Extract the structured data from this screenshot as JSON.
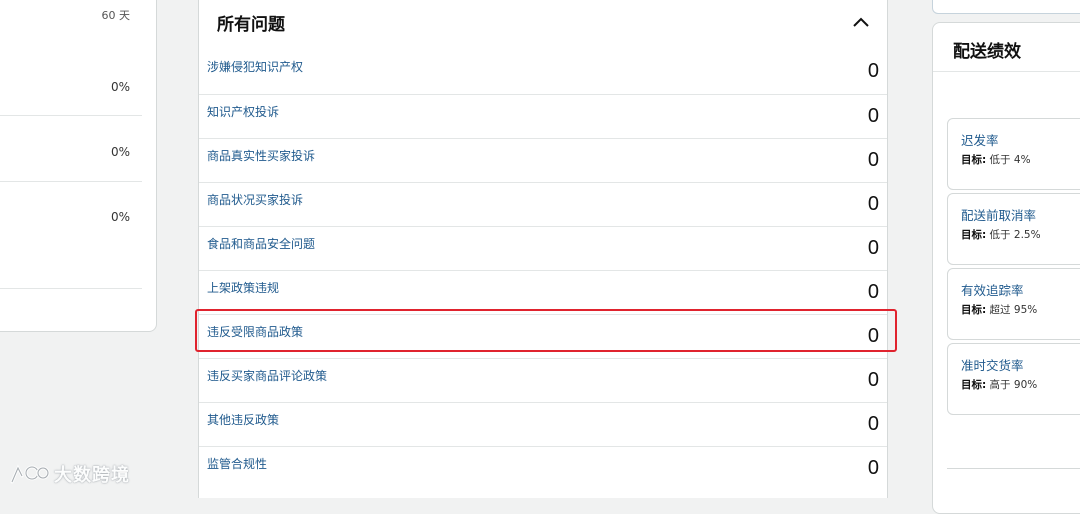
{
  "left_panel": {
    "top_value": "60 天",
    "values": [
      "0%",
      "0%",
      "0%"
    ]
  },
  "issues_panel": {
    "title": "所有问题",
    "rows": [
      {
        "label": "涉嫌侵犯知识产权",
        "count": "0"
      },
      {
        "label": "知识产权投诉",
        "count": "0"
      },
      {
        "label": "商品真实性买家投诉",
        "count": "0"
      },
      {
        "label": "商品状况买家投诉",
        "count": "0"
      },
      {
        "label": "食品和商品安全问题",
        "count": "0"
      },
      {
        "label": "上架政策违规",
        "count": "0"
      },
      {
        "label": "违反受限商品政策",
        "count": "0"
      },
      {
        "label": "违反买家商品评论政策",
        "count": "0"
      },
      {
        "label": "其他违反政策",
        "count": "0"
      },
      {
        "label": "监管合规性",
        "count": "0"
      }
    ],
    "highlight_color": "#e0232e"
  },
  "delivery_panel": {
    "title": "配送绩效",
    "metrics": [
      {
        "name": "迟发率",
        "target_label": "目标:",
        "target_value": "低于 4%"
      },
      {
        "name": "配送前取消率",
        "target_label": "目标:",
        "target_value": "低于 2.5%"
      },
      {
        "name": "有效追踪率",
        "target_label": "目标:",
        "target_value": "超过 95%"
      },
      {
        "name": "准时交货率",
        "target_label": "目标:",
        "target_value": "高于 90%"
      }
    ]
  },
  "watermark": {
    "text": "大数跨境"
  },
  "colors": {
    "link": "#215b8e",
    "border": "#d5d9d9",
    "background": "#f1f2f2"
  }
}
